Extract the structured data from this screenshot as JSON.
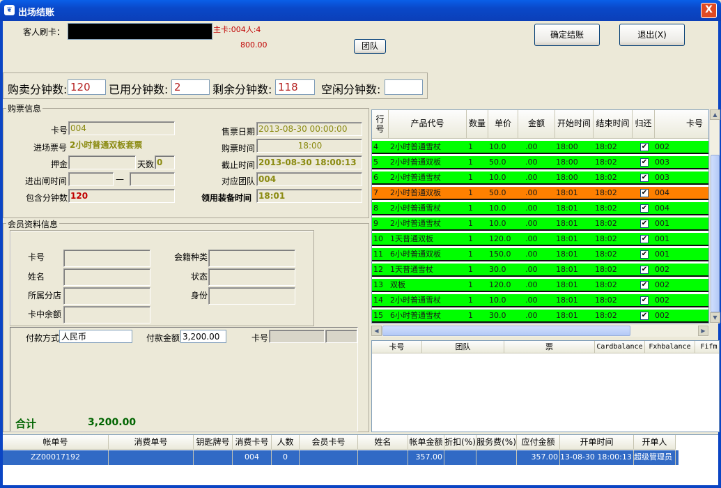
{
  "window": {
    "title": "出场结账",
    "close_label": "X"
  },
  "top": {
    "card_label": "客人刷卡：",
    "main_card": "主卡:004人:4",
    "amount": "800.00",
    "team_button": "团队",
    "confirm_button": "确定结账",
    "exit_button": "退出(X)"
  },
  "minutes": {
    "bought_label": "购卖分钟数:",
    "bought_value": "120",
    "used_label": "已用分钟数:",
    "used_value": "2",
    "remaining_label": "剩余分钟数:",
    "remaining_value": "118",
    "idle_label": "空闲分钟数:",
    "idle_value": ""
  },
  "ticket": {
    "group_label": "购票信息",
    "card_no_label": "卡号",
    "card_no": "004",
    "ticket_type_label": "进场票号",
    "ticket_type": "2小时普通双板套票",
    "deposit_label": "押金",
    "deposit": "",
    "days_label": "天数",
    "days": "0",
    "inout_label": "进出闸时间",
    "dash": "—",
    "included_minutes_label": "包含分钟数",
    "included_minutes": "120",
    "sale_date_label": "售票日期",
    "sale_date": "2013-08-30 00:00:00",
    "purchase_time_label": "购票时间",
    "purchase_time": "18:00",
    "deadline_label": "截止时间",
    "deadline": "2013-08-30  18:00:13",
    "team_label": "对应团队",
    "team": "004",
    "equip_time_label": "领用装备时间",
    "equip_time": "18:01"
  },
  "member": {
    "group_label": "会员资料信息",
    "card_label": "卡号",
    "name_label": "姓名",
    "branch_label": "所属分店",
    "balance_label": "卡中余额",
    "type_label": "会籍种类",
    "status_label": "状态",
    "identity_label": "身份"
  },
  "payment": {
    "method_label": "付款方式",
    "method": "人民币",
    "amount_label": "付款金额",
    "amount": "3,200.00",
    "card_label": "卡号",
    "total_label": "合计",
    "total": "3,200.00"
  },
  "grid": {
    "headers": [
      "行号",
      "产品代号",
      "数量",
      "单价",
      "金额",
      "开始时间",
      "结束时间",
      "归还",
      "卡号"
    ],
    "rows": [
      {
        "no": "4",
        "product": "2小时普通雪杖",
        "qty": "1",
        "price": "10.0",
        "amount": ".00",
        "start": "18:00",
        "end": "18:02",
        "card": "002",
        "selected": false
      },
      {
        "no": "5",
        "product": "2小时普通双板",
        "qty": "1",
        "price": "50.0",
        "amount": ".00",
        "start": "18:00",
        "end": "18:02",
        "card": "003",
        "selected": false
      },
      {
        "no": "6",
        "product": "2小时普通雪杖",
        "qty": "1",
        "price": "10.0",
        "amount": ".00",
        "start": "18:00",
        "end": "18:02",
        "card": "003",
        "selected": false
      },
      {
        "no": "7",
        "product": "2小时普通双板",
        "qty": "1",
        "price": "50.0",
        "amount": ".00",
        "start": "18:01",
        "end": "18:02",
        "card": "004",
        "selected": true
      },
      {
        "no": "8",
        "product": "2小时普通雪杖",
        "qty": "1",
        "price": "10.0",
        "amount": ".00",
        "start": "18:01",
        "end": "18:02",
        "card": "004",
        "selected": false
      },
      {
        "no": "9",
        "product": "2小时普通雪杖",
        "qty": "1",
        "price": "10.0",
        "amount": ".00",
        "start": "18:01",
        "end": "18:02",
        "card": "001",
        "selected": false
      },
      {
        "no": "10",
        "product": "1天普通双板",
        "qty": "1",
        "price": "120.0",
        "amount": ".00",
        "start": "18:01",
        "end": "18:02",
        "card": "001",
        "selected": false
      },
      {
        "no": "11",
        "product": "6小时普通双板",
        "qty": "1",
        "price": "150.0",
        "amount": ".00",
        "start": "18:01",
        "end": "18:02",
        "card": "001",
        "selected": false
      },
      {
        "no": "12",
        "product": "1天普通雪杖",
        "qty": "1",
        "price": "30.0",
        "amount": ".00",
        "start": "18:01",
        "end": "18:02",
        "card": "002",
        "selected": false
      },
      {
        "no": "13",
        "product": "双板",
        "qty": "1",
        "price": "120.0",
        "amount": ".00",
        "start": "18:01",
        "end": "18:02",
        "card": "002",
        "selected": false
      },
      {
        "no": "14",
        "product": "2小时普通雪杖",
        "qty": "1",
        "price": "10.0",
        "amount": ".00",
        "start": "18:01",
        "end": "18:02",
        "card": "002",
        "selected": false
      },
      {
        "no": "15",
        "product": "6小时普通雪杖",
        "qty": "1",
        "price": "30.0",
        "amount": ".00",
        "start": "18:01",
        "end": "18:02",
        "card": "002",
        "selected": false
      }
    ]
  },
  "subgrid": {
    "headers": [
      "卡号",
      "团队",
      "票",
      "Cardbalance",
      "Fxhbalance",
      "Fifm"
    ]
  },
  "bottom": {
    "headers": [
      "帐单号",
      "消费单号",
      "钥匙牌号",
      "消费卡号",
      "人数",
      "会员卡号",
      "姓名",
      "帐单金额",
      "折扣(%)",
      "服务费(%)",
      "应付金额",
      "开单时间",
      "开单人"
    ],
    "row": [
      "ZZ00017192",
      "",
      "",
      "004",
      "0",
      "",
      "",
      "357.00",
      "",
      "",
      "357.00",
      "13-08-30 18:00:13",
      "超级管理员"
    ]
  },
  "colors": {
    "row_green": "#00ff00",
    "row_selected": "#ff8000",
    "total_green": "#006400",
    "title_blue": "#0a48c8"
  }
}
